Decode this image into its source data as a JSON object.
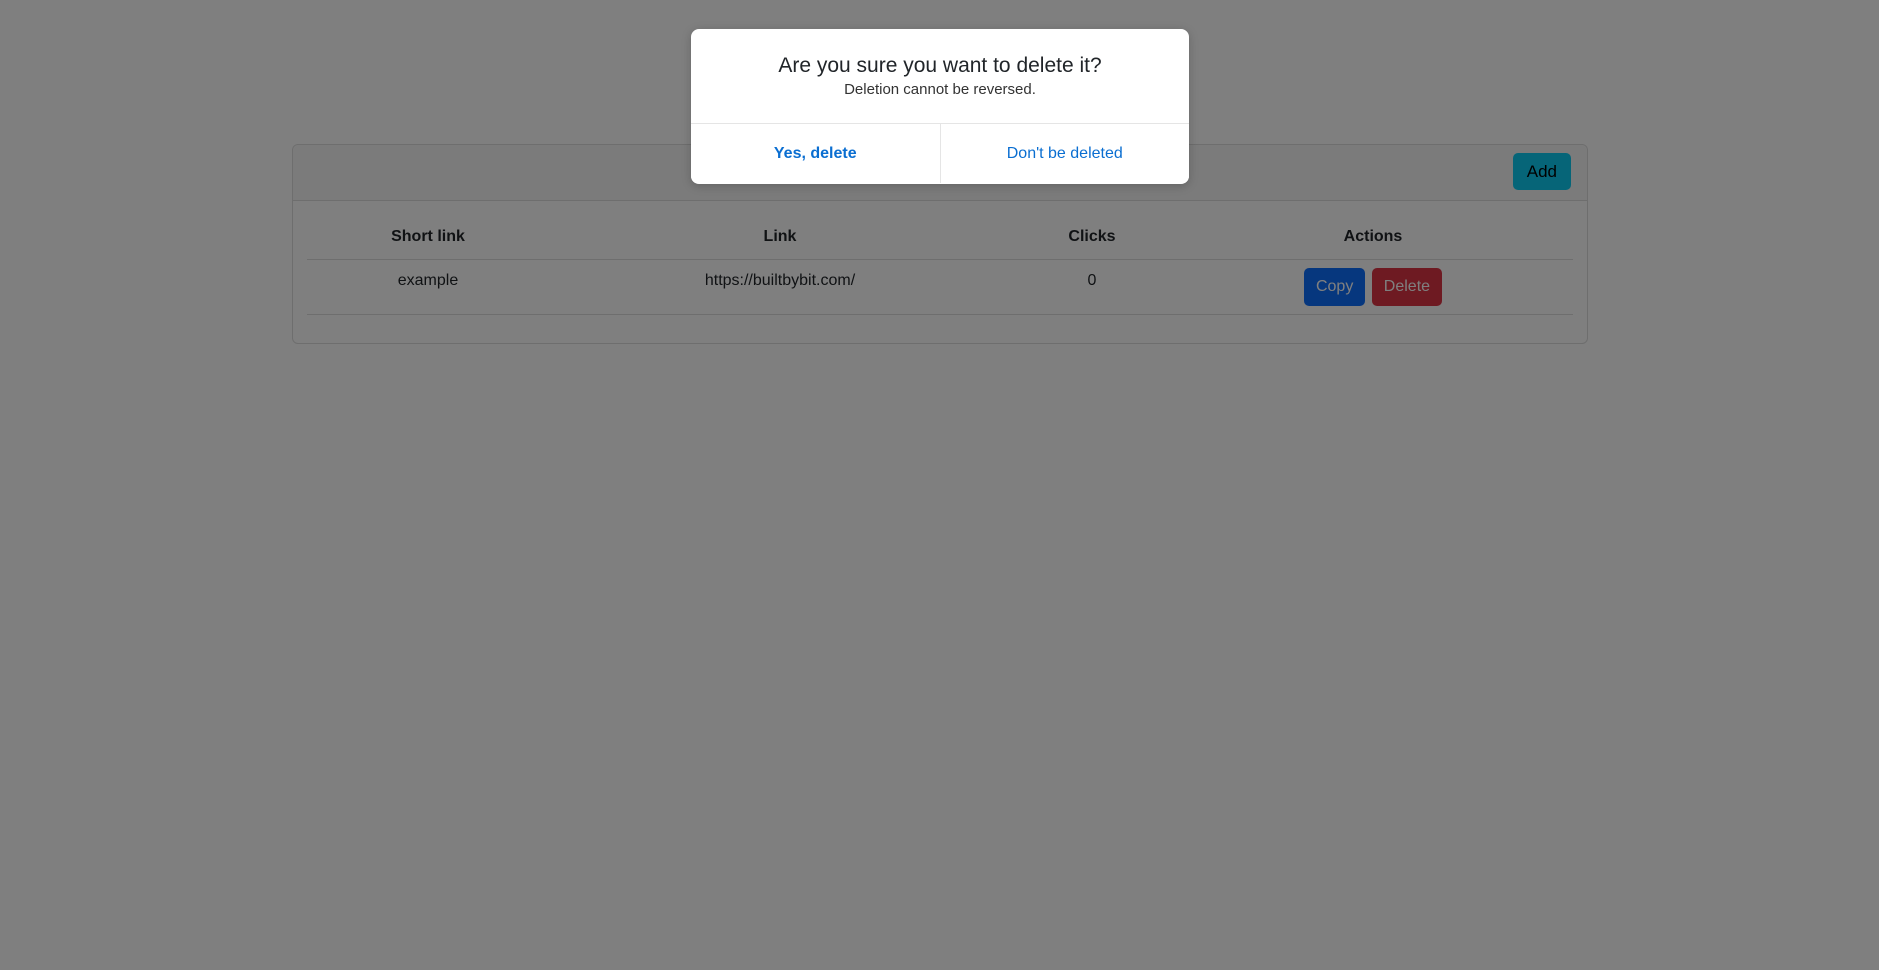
{
  "toolbar": {
    "add_label": "Add"
  },
  "table": {
    "headers": [
      "Short link",
      "Link",
      "Clicks",
      "Actions"
    ],
    "rows": [
      {
        "short_link": "example",
        "link": "https://builtbybit.com/",
        "clicks": "0",
        "copy_label": "Copy",
        "delete_label": "Delete"
      }
    ]
  },
  "dialog": {
    "title": "Are you sure you want to delete it?",
    "message": "Deletion cannot be reversed.",
    "confirm_label": "Yes, delete",
    "cancel_label": "Don't be deleted"
  },
  "colors": {
    "add": "#0dcaf0",
    "copy": "#0d6efd",
    "delete": "#dc3545",
    "dialog_link": "#0a6ed1"
  }
}
